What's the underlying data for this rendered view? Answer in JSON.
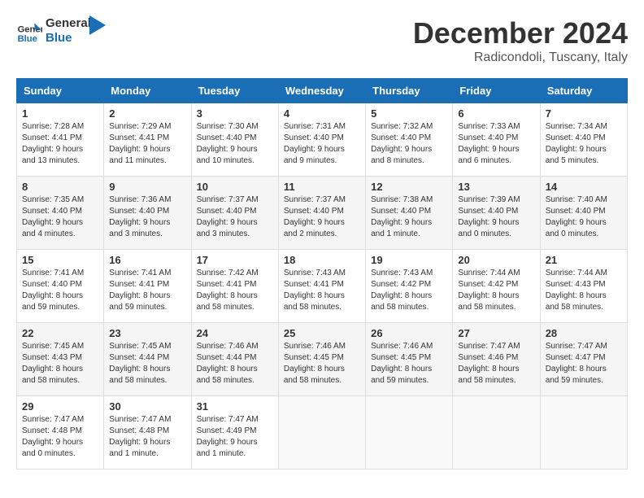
{
  "header": {
    "logo_line1": "General",
    "logo_line2": "Blue",
    "month": "December 2024",
    "location": "Radicondoli, Tuscany, Italy"
  },
  "weekdays": [
    "Sunday",
    "Monday",
    "Tuesday",
    "Wednesday",
    "Thursday",
    "Friday",
    "Saturday"
  ],
  "weeks": [
    [
      {
        "day": "1",
        "sunrise": "7:28 AM",
        "sunset": "4:41 PM",
        "daylight": "9 hours and 13 minutes."
      },
      {
        "day": "2",
        "sunrise": "7:29 AM",
        "sunset": "4:41 PM",
        "daylight": "9 hours and 11 minutes."
      },
      {
        "day": "3",
        "sunrise": "7:30 AM",
        "sunset": "4:40 PM",
        "daylight": "9 hours and 10 minutes."
      },
      {
        "day": "4",
        "sunrise": "7:31 AM",
        "sunset": "4:40 PM",
        "daylight": "9 hours and 9 minutes."
      },
      {
        "day": "5",
        "sunrise": "7:32 AM",
        "sunset": "4:40 PM",
        "daylight": "9 hours and 8 minutes."
      },
      {
        "day": "6",
        "sunrise": "7:33 AM",
        "sunset": "4:40 PM",
        "daylight": "9 hours and 6 minutes."
      },
      {
        "day": "7",
        "sunrise": "7:34 AM",
        "sunset": "4:40 PM",
        "daylight": "9 hours and 5 minutes."
      }
    ],
    [
      {
        "day": "8",
        "sunrise": "7:35 AM",
        "sunset": "4:40 PM",
        "daylight": "9 hours and 4 minutes."
      },
      {
        "day": "9",
        "sunrise": "7:36 AM",
        "sunset": "4:40 PM",
        "daylight": "9 hours and 3 minutes."
      },
      {
        "day": "10",
        "sunrise": "7:37 AM",
        "sunset": "4:40 PM",
        "daylight": "9 hours and 3 minutes."
      },
      {
        "day": "11",
        "sunrise": "7:37 AM",
        "sunset": "4:40 PM",
        "daylight": "9 hours and 2 minutes."
      },
      {
        "day": "12",
        "sunrise": "7:38 AM",
        "sunset": "4:40 PM",
        "daylight": "9 hours and 1 minute."
      },
      {
        "day": "13",
        "sunrise": "7:39 AM",
        "sunset": "4:40 PM",
        "daylight": "9 hours and 0 minutes."
      },
      {
        "day": "14",
        "sunrise": "7:40 AM",
        "sunset": "4:40 PM",
        "daylight": "9 hours and 0 minutes."
      }
    ],
    [
      {
        "day": "15",
        "sunrise": "7:41 AM",
        "sunset": "4:40 PM",
        "daylight": "8 hours and 59 minutes."
      },
      {
        "day": "16",
        "sunrise": "7:41 AM",
        "sunset": "4:41 PM",
        "daylight": "8 hours and 59 minutes."
      },
      {
        "day": "17",
        "sunrise": "7:42 AM",
        "sunset": "4:41 PM",
        "daylight": "8 hours and 58 minutes."
      },
      {
        "day": "18",
        "sunrise": "7:43 AM",
        "sunset": "4:41 PM",
        "daylight": "8 hours and 58 minutes."
      },
      {
        "day": "19",
        "sunrise": "7:43 AM",
        "sunset": "4:42 PM",
        "daylight": "8 hours and 58 minutes."
      },
      {
        "day": "20",
        "sunrise": "7:44 AM",
        "sunset": "4:42 PM",
        "daylight": "8 hours and 58 minutes."
      },
      {
        "day": "21",
        "sunrise": "7:44 AM",
        "sunset": "4:43 PM",
        "daylight": "8 hours and 58 minutes."
      }
    ],
    [
      {
        "day": "22",
        "sunrise": "7:45 AM",
        "sunset": "4:43 PM",
        "daylight": "8 hours and 58 minutes."
      },
      {
        "day": "23",
        "sunrise": "7:45 AM",
        "sunset": "4:44 PM",
        "daylight": "8 hours and 58 minutes."
      },
      {
        "day": "24",
        "sunrise": "7:46 AM",
        "sunset": "4:44 PM",
        "daylight": "8 hours and 58 minutes."
      },
      {
        "day": "25",
        "sunrise": "7:46 AM",
        "sunset": "4:45 PM",
        "daylight": "8 hours and 58 minutes."
      },
      {
        "day": "26",
        "sunrise": "7:46 AM",
        "sunset": "4:45 PM",
        "daylight": "8 hours and 59 minutes."
      },
      {
        "day": "27",
        "sunrise": "7:47 AM",
        "sunset": "4:46 PM",
        "daylight": "8 hours and 58 minutes."
      },
      {
        "day": "28",
        "sunrise": "7:47 AM",
        "sunset": "4:47 PM",
        "daylight": "8 hours and 59 minutes."
      }
    ],
    [
      {
        "day": "29",
        "sunrise": "7:47 AM",
        "sunset": "4:48 PM",
        "daylight": "9 hours and 0 minutes."
      },
      {
        "day": "30",
        "sunrise": "7:47 AM",
        "sunset": "4:48 PM",
        "daylight": "9 hours and 1 minute."
      },
      {
        "day": "31",
        "sunrise": "7:47 AM",
        "sunset": "4:49 PM",
        "daylight": "9 hours and 1 minute."
      },
      null,
      null,
      null,
      null
    ]
  ],
  "labels": {
    "sunrise_prefix": "Sunrise: ",
    "sunset_prefix": "Sunset: ",
    "daylight_prefix": "Daylight: "
  }
}
